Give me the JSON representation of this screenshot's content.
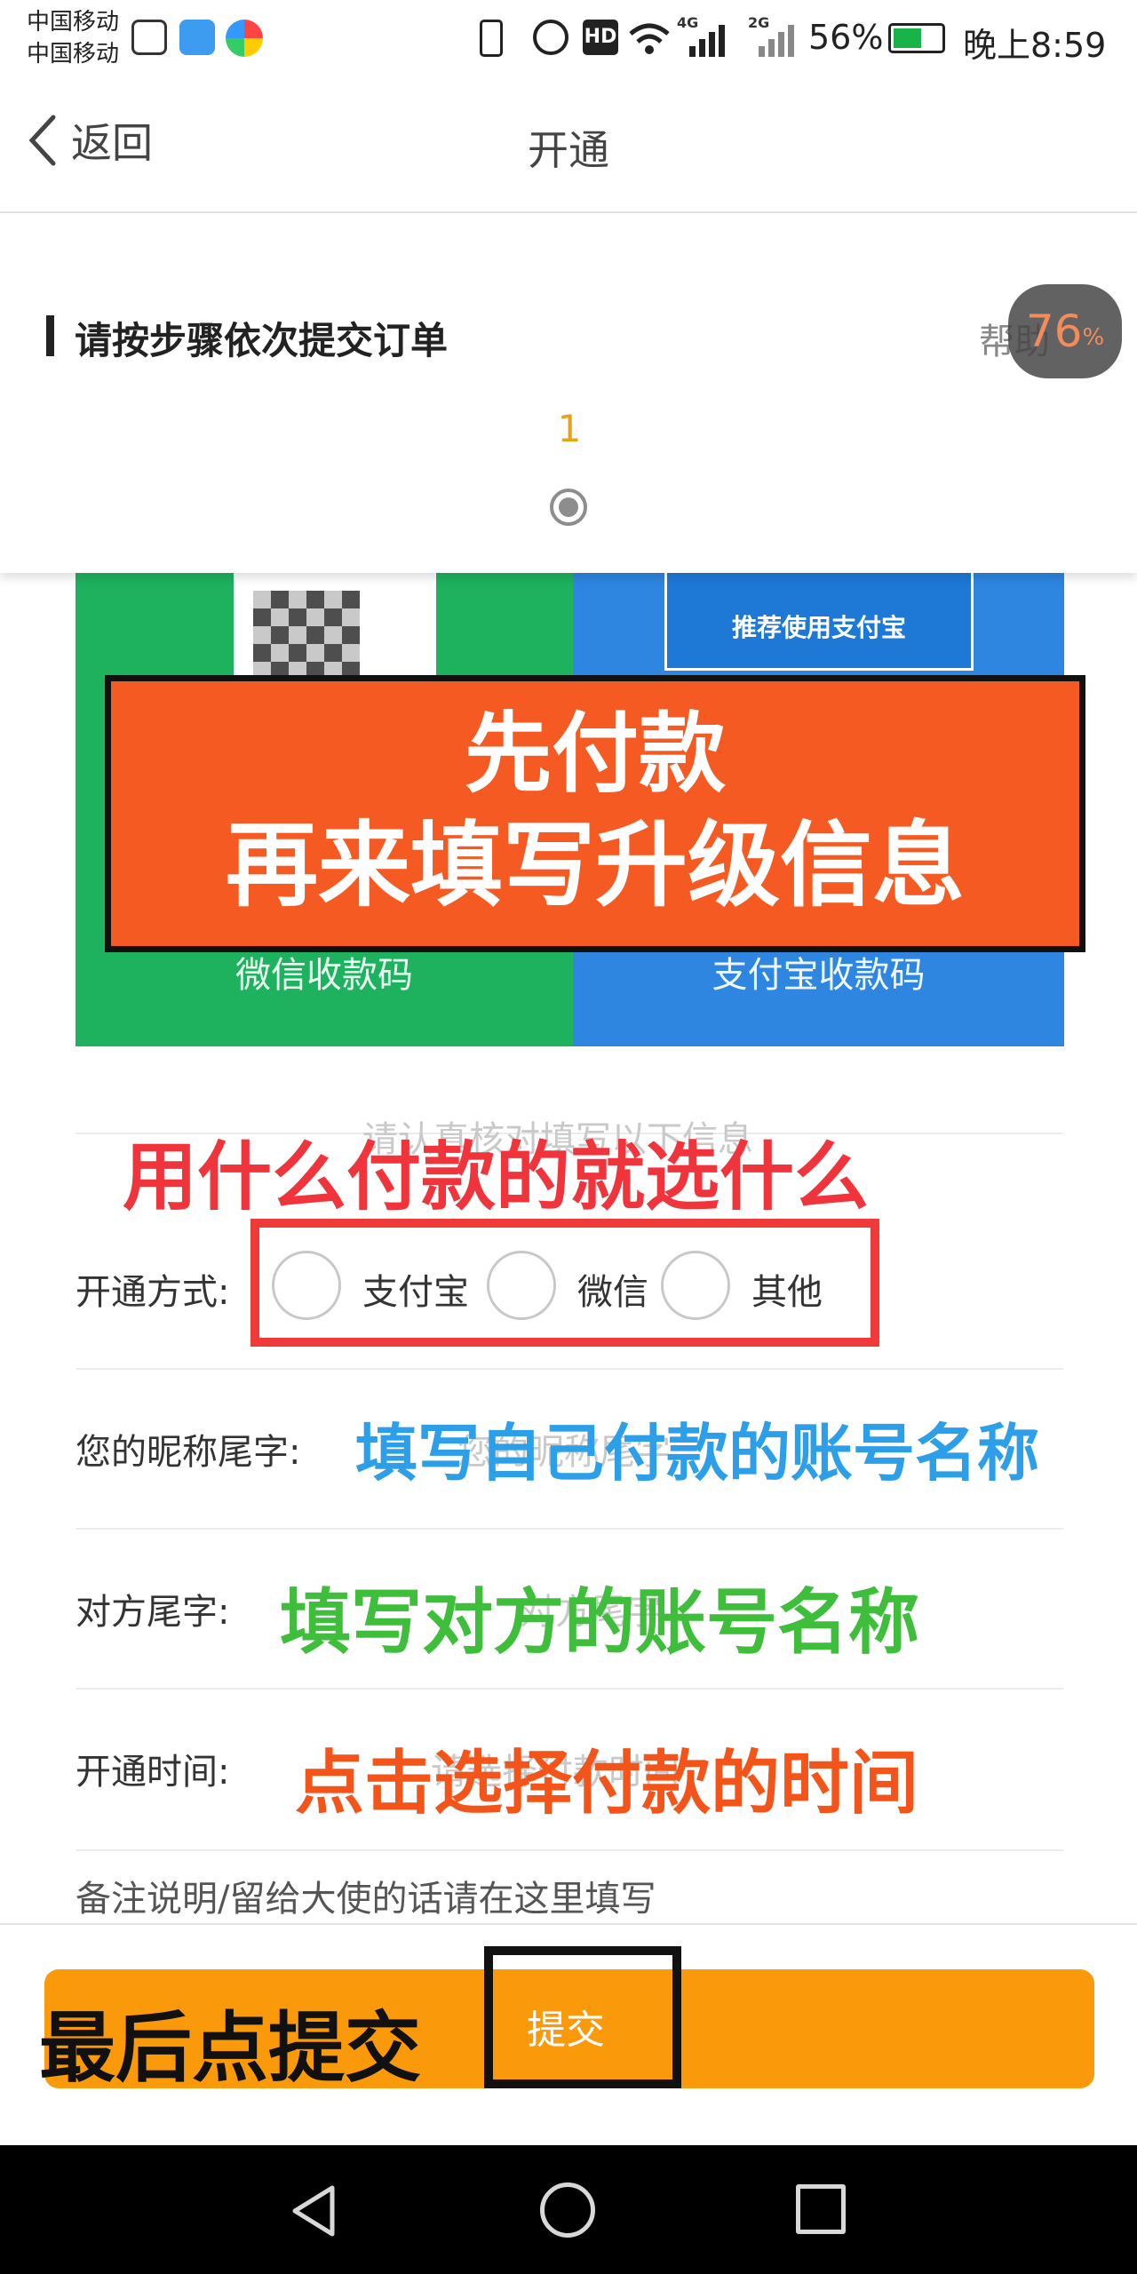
{
  "status_bar": {
    "carrier_1": "中国移动",
    "carrier_2": "中国移动",
    "battery": "56%",
    "time": "晚上8:59",
    "signal_1": "4G",
    "signal_2": "2G",
    "hd": "HD"
  },
  "nav": {
    "back_label": "返回",
    "title": "开通"
  },
  "order_card": {
    "heading": "请按步骤依次提交订单",
    "help_label": "帮助",
    "progress_badge": "76",
    "progress_unit": "%",
    "step_number": "1"
  },
  "payment_codes": {
    "alipay_banner": "推荐使用支付宝",
    "wechat_label": "微信收款码",
    "alipay_label": "支付宝收款码"
  },
  "overlay_banner": {
    "line1": "先付款",
    "line2": "再来填写升级信息"
  },
  "form": {
    "instruction_hint": "请认真核对填写以下信息",
    "instruction_annotation": "用什么付款的就选什么",
    "method_label": "开通方式:",
    "method_options": [
      "支付宝",
      "微信",
      "其他"
    ],
    "nickname_label": "您的昵称尾字:",
    "nickname_placeholder": "您的昵称尾字",
    "nickname_annotation": "填写自己付款的账号名称",
    "other_label": "对方尾字:",
    "other_placeholder": "对方尾字",
    "other_annotation": "填写对方的账号名称",
    "time_label": "开通时间:",
    "time_placeholder": "请选择付款时间",
    "time_annotation": "点击选择付款的时间",
    "remark_placeholder": "备注说明/留给大使的话请在这里填写"
  },
  "submit": {
    "annotation": "最后点提交",
    "label": "提交"
  },
  "colors": {
    "accent_orange": "#fa9a0a",
    "banner_orange": "#f55a22",
    "wechat_green": "#1eb15e",
    "alipay_blue": "#2e86e0",
    "annotation_red": "#f0343c",
    "annotation_blue": "#2c9fe8",
    "annotation_green": "#3fbe3c",
    "annotation_orange": "#f2541a"
  },
  "icons": [
    "back-chevron-icon",
    "vibrate-icon",
    "alarm-icon",
    "wifi-icon",
    "signal-icon",
    "battery-icon",
    "radio-button-icon",
    "nav-back-icon",
    "nav-home-icon",
    "nav-recents-icon"
  ]
}
